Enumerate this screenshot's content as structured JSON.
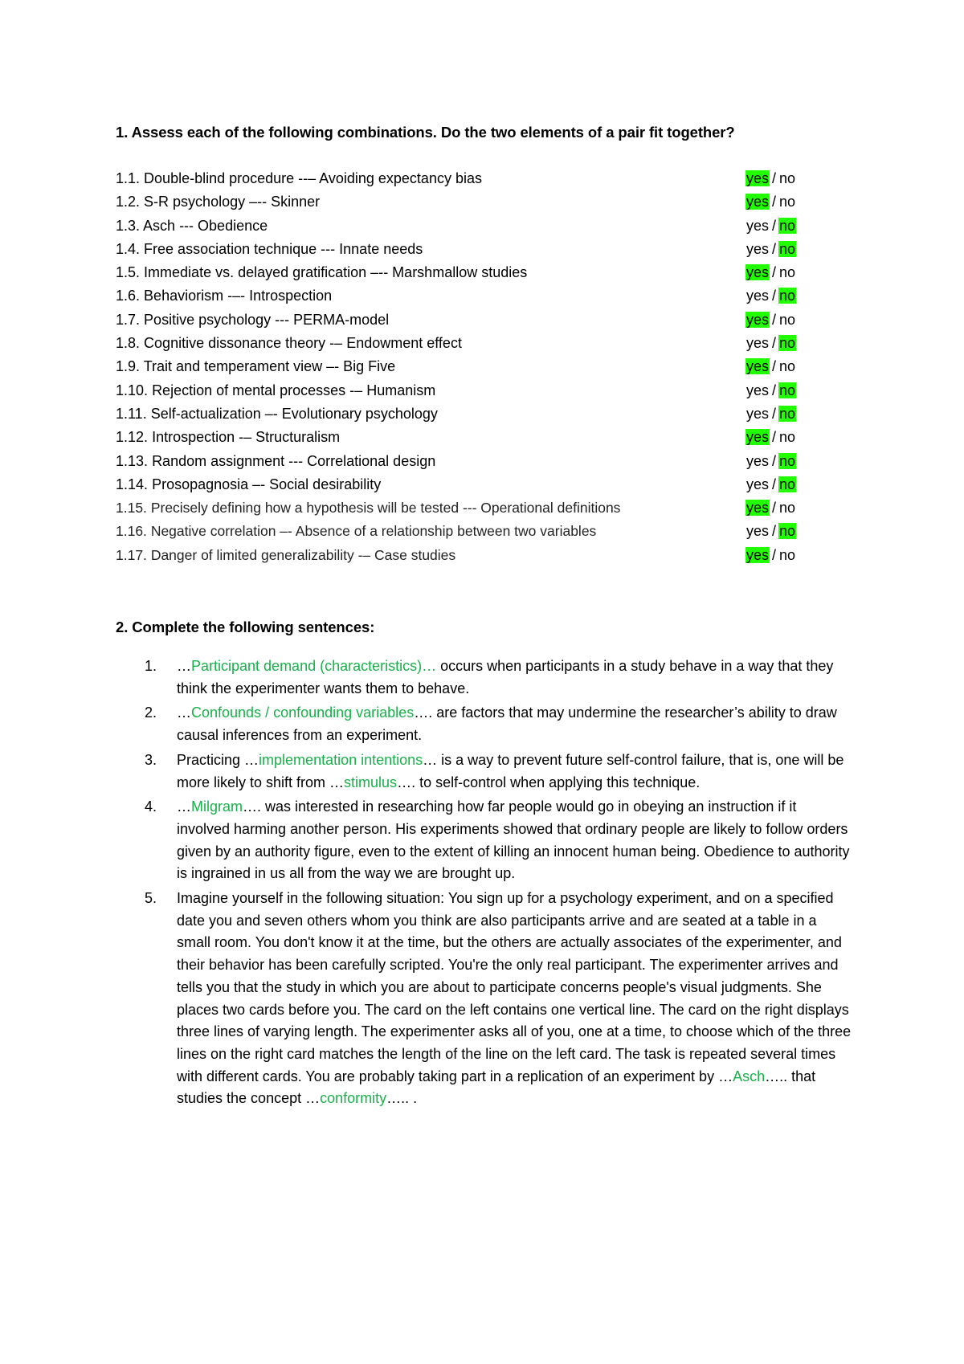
{
  "section1": {
    "heading": "1. Assess each of the following combinations. Do the two elements of a pair fit together?",
    "options": {
      "yes": "yes",
      "separator": "/",
      "no": "no"
    },
    "highlight_color": "#22ff00",
    "items": [
      {
        "num": "1.1.",
        "text": "Double-blind procedure --– Avoiding expectancy bias",
        "answer": "yes"
      },
      {
        "num": "1.2.",
        "text": "S-R psychology –-- Skinner",
        "answer": "yes"
      },
      {
        "num": "1.3.",
        "text": "Asch --- Obedience",
        "answer": "no"
      },
      {
        "num": "1.4.",
        "text": "Free association technique --- Innate needs",
        "answer": "no"
      },
      {
        "num": "1.5.",
        "text": "Immediate vs. delayed gratification –-- Marshmallow studies",
        "answer": "yes"
      },
      {
        "num": "1.6.",
        "text": "Behaviorism -–- Introspection",
        "answer": "no"
      },
      {
        "num": "1.7.",
        "text": "Positive psychology --- PERMA-model",
        "answer": "yes"
      },
      {
        "num": "1.8.",
        "text": "Cognitive dissonance theory -– Endowment effect",
        "answer": "no"
      },
      {
        "num": "1.9.",
        "text": "Trait and temperament view –- Big Five",
        "answer": "yes"
      },
      {
        "num": "1.10.",
        "text": "Rejection of mental processes -– Humanism",
        "answer": "no"
      },
      {
        "num": "1.11.",
        "text": "Self-actualization –- Evolutionary psychology",
        "answer": "no"
      },
      {
        "num": "1.12.",
        "text": "Introspection -– Structuralism",
        "answer": "yes"
      },
      {
        "num": "1.13.",
        "text": "Random assignment --- Correlational design",
        "answer": "no"
      },
      {
        "num": "1.14.",
        "text": "Prosopagnosia –- Social desirability",
        "answer": "no"
      },
      {
        "num": "1.15.",
        "text": "Precisely defining how a hypothesis will be tested --- Operational definitions",
        "answer": "yes"
      },
      {
        "num": "1.16.",
        "text": "Negative correlation –- Absence of a relationship between two variables",
        "answer": "no"
      },
      {
        "num": "1.17.",
        "text": "Danger of limited generalizability -– Case studies",
        "answer": "yes"
      }
    ]
  },
  "section2": {
    "heading": "2. Complete the following sentences:",
    "answer_color": "#19b04b",
    "items": [
      {
        "num": "1.",
        "parts": [
          {
            "t": "…",
            "fill": false
          },
          {
            "t": "Participant demand (characteristics)…",
            "fill": true
          },
          {
            "t": " occurs when participants in a study behave in a way that they think the experimenter wants them to behave.",
            "fill": false
          }
        ]
      },
      {
        "num": "2.",
        "parts": [
          {
            "t": "…",
            "fill": false
          },
          {
            "t": "Confounds / confounding variables",
            "fill": true
          },
          {
            "t": "…. are factors that may undermine the researcher’s ability to draw causal inferences from an experiment.",
            "fill": false
          }
        ]
      },
      {
        "num": "3.",
        "parts": [
          {
            "t": "Practicing …",
            "fill": false
          },
          {
            "t": "implementation intentions",
            "fill": true
          },
          {
            "t": "… is a way to prevent future self-control failure, that is, one will be more likely to shift from …",
            "fill": false
          },
          {
            "t": "stimulus",
            "fill": true
          },
          {
            "t": "…. to self-control when applying this technique.",
            "fill": false
          }
        ]
      },
      {
        "num": "4.",
        "parts": [
          {
            "t": "…",
            "fill": false
          },
          {
            "t": "Milgram",
            "fill": true
          },
          {
            "t": "…. was interested in researching how far people would go in obeying an instruction if it involved harming another person. His experiments showed that ordinary people are likely to follow orders given by an authority figure, even to the extent of killing an innocent human being.  Obedience to authority is ingrained in us all from the way we are brought up.",
            "fill": false
          }
        ]
      },
      {
        "num": "5.",
        "parts": [
          {
            "t": "Imagine yourself in the following situation: You sign up for a psychology experiment, and on a specified date you and seven others whom you think are also participants arrive and are seated at a table in a small room. You don't know it at the time, but the others are actually associates of the experimenter, and their behavior has been carefully scripted. You're the only real participant. The experimenter arrives and tells you that the study in which you are about to participate concerns people's visual judgments. She places two cards before you. The card on the left contains one vertical line. The card on the right displays three lines of varying length. The experimenter asks all of you, one at a time, to choose which of the three lines on the right card matches the length of the line on the left card. The task is repeated several times with different cards. You are probably taking part in a replication of an experiment by …",
            "fill": false
          },
          {
            "t": "Asch",
            "fill": true
          },
          {
            "t": "….. that studies the concept …",
            "fill": false
          },
          {
            "t": "conformity",
            "fill": true
          },
          {
            "t": "….. .",
            "fill": false
          }
        ]
      }
    ]
  }
}
